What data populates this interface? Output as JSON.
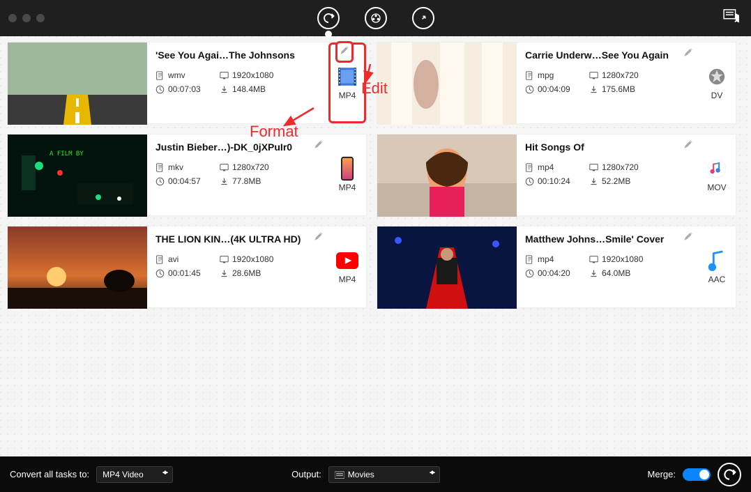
{
  "topbar": {
    "tabs": [
      {
        "name": "convert",
        "active": true
      },
      {
        "name": "download",
        "active": false
      },
      {
        "name": "share",
        "active": false
      }
    ]
  },
  "annotations": {
    "format_label": "Format",
    "edit_label": "Edit"
  },
  "bottombar": {
    "convert_all_label": "Convert all tasks to:",
    "convert_all_value": "MP4 Video",
    "output_label": "Output:",
    "output_value": "Movies",
    "merge_label": "Merge:",
    "merge_on": true
  },
  "items": [
    {
      "title": "'See You Agai…The Johnsons",
      "ext": "wmv",
      "resolution": "1920x1080",
      "duration": "00:07:03",
      "size": "148.4MB",
      "target_label": "MP4",
      "thumb_kind": "road",
      "target_icon": "film-blue",
      "highlight_format": true,
      "highlight_edit": true
    },
    {
      "title": "Carrie Underw…See You Again",
      "ext": "mpg",
      "resolution": "1280x720",
      "duration": "00:04:09",
      "size": "175.6MB",
      "target_label": "DV",
      "thumb_kind": "curtain",
      "target_icon": "star"
    },
    {
      "title": "Justin Bieber…)-DK_0jXPuIr0",
      "ext": "mkv",
      "resolution": "1280x720",
      "duration": "00:04:57",
      "size": "77.8MB",
      "target_label": "MP4",
      "thumb_kind": "night-city",
      "target_icon": "phone"
    },
    {
      "title": "Hit Songs Of",
      "ext": "mp4",
      "resolution": "1280x720",
      "duration": "00:10:24",
      "size": "52.2MB",
      "target_label": "MOV",
      "thumb_kind": "pink-girl",
      "target_icon": "music-rainbow"
    },
    {
      "title": "THE LION KIN…(4K ULTRA HD)",
      "ext": "avi",
      "resolution": "1920x1080",
      "duration": "00:01:45",
      "size": "28.6MB",
      "target_label": "MP4",
      "thumb_kind": "sunset",
      "target_icon": "youtube"
    },
    {
      "title": "Matthew Johns…Smile' Cover",
      "ext": "mp4",
      "resolution": "1920x1080",
      "duration": "00:04:20",
      "size": "64.0MB",
      "target_label": "AAC",
      "thumb_kind": "stage",
      "target_icon": "music-blue"
    }
  ]
}
